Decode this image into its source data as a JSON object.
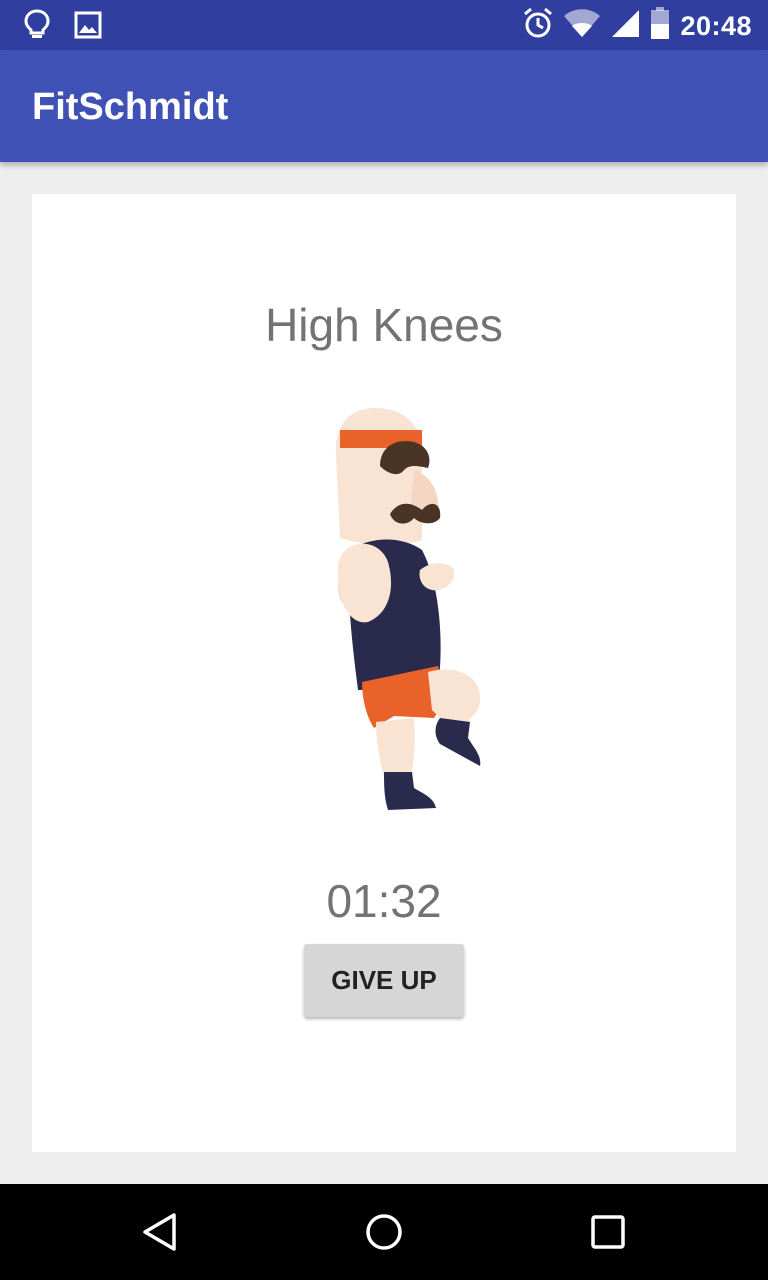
{
  "status_bar": {
    "time": "20:48",
    "left_icons": [
      "lightbulb-icon",
      "image-icon"
    ],
    "right_icons": [
      "alarm-icon",
      "wifi-icon",
      "signal-icon",
      "battery-icon"
    ]
  },
  "app_bar": {
    "title": "FitSchmidt"
  },
  "exercise": {
    "name": "High Knees",
    "illustration": "high-knees-man-illustration",
    "timer": "01:32",
    "give_up_label": "GIVE UP"
  },
  "nav_bar": {
    "items": [
      "back-icon",
      "home-icon",
      "recents-icon"
    ]
  },
  "colors": {
    "status_bar": "#303f9f",
    "app_bar": "#3f51b5",
    "background": "#eeeeee",
    "headband": "#e8622a",
    "shirt": "#2a2a4c",
    "shorts": "#e8622a",
    "skin": "#f9e3d3"
  }
}
